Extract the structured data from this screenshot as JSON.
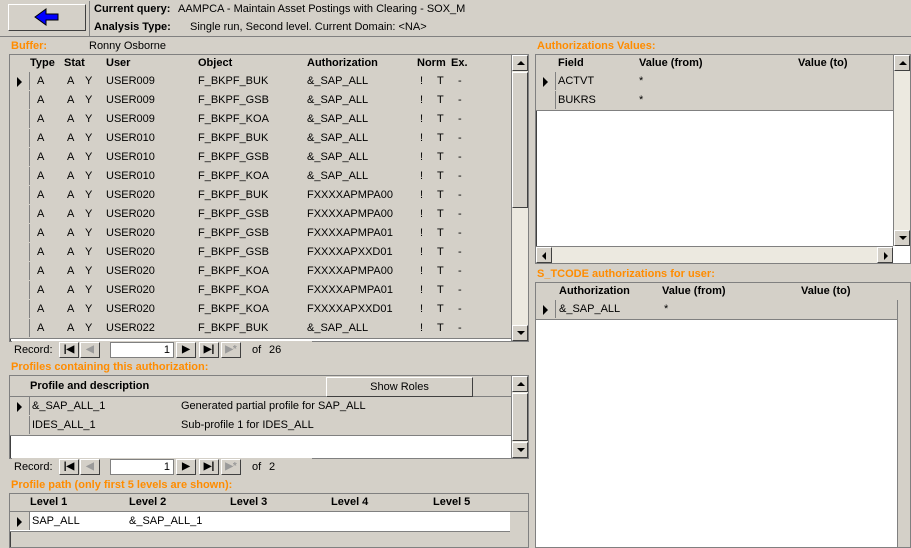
{
  "header": {
    "current_query_label": "Current query:",
    "current_query_value": "AAMPCA - Maintain Asset Postings with Clearing - SOX_M",
    "analysis_type_label": "Analysis Type:",
    "analysis_type_value": "Single run, Second level. Current Domain: <NA>",
    "back_button_icon": "arrow-left-icon"
  },
  "buffer": {
    "label": "Buffer:",
    "user_name": "Ronny Osborne",
    "columns": [
      "Type",
      "Stat",
      "User",
      "Object",
      "Authorization",
      "Norm",
      "Ex."
    ],
    "rows": [
      {
        "type": "A",
        "stat": "A",
        "y": "Y",
        "user": "USER009",
        "object": "F_BKPF_BUK",
        "auth": "&_SAP_ALL",
        "norm": "!",
        "t": "T",
        "ex": "-"
      },
      {
        "type": "A",
        "stat": "A",
        "y": "Y",
        "user": "USER009",
        "object": "F_BKPF_GSB",
        "auth": "&_SAP_ALL",
        "norm": "!",
        "t": "T",
        "ex": "-"
      },
      {
        "type": "A",
        "stat": "A",
        "y": "Y",
        "user": "USER009",
        "object": "F_BKPF_KOA",
        "auth": "&_SAP_ALL",
        "norm": "!",
        "t": "T",
        "ex": "-"
      },
      {
        "type": "A",
        "stat": "A",
        "y": "Y",
        "user": "USER010",
        "object": "F_BKPF_BUK",
        "auth": "&_SAP_ALL",
        "norm": "!",
        "t": "T",
        "ex": "-"
      },
      {
        "type": "A",
        "stat": "A",
        "y": "Y",
        "user": "USER010",
        "object": "F_BKPF_GSB",
        "auth": "&_SAP_ALL",
        "norm": "!",
        "t": "T",
        "ex": "-"
      },
      {
        "type": "A",
        "stat": "A",
        "y": "Y",
        "user": "USER010",
        "object": "F_BKPF_KOA",
        "auth": "&_SAP_ALL",
        "norm": "!",
        "t": "T",
        "ex": "-"
      },
      {
        "type": "A",
        "stat": "A",
        "y": "Y",
        "user": "USER020",
        "object": "F_BKPF_BUK",
        "auth": "FXXXXAPMPA00",
        "norm": "!",
        "t": "T",
        "ex": "-"
      },
      {
        "type": "A",
        "stat": "A",
        "y": "Y",
        "user": "USER020",
        "object": "F_BKPF_GSB",
        "auth": "FXXXXAPMPA00",
        "norm": "!",
        "t": "T",
        "ex": "-"
      },
      {
        "type": "A",
        "stat": "A",
        "y": "Y",
        "user": "USER020",
        "object": "F_BKPF_GSB",
        "auth": "FXXXXAPMPA01",
        "norm": "!",
        "t": "T",
        "ex": "-"
      },
      {
        "type": "A",
        "stat": "A",
        "y": "Y",
        "user": "USER020",
        "object": "F_BKPF_GSB",
        "auth": "FXXXXAPXXD01",
        "norm": "!",
        "t": "T",
        "ex": "-"
      },
      {
        "type": "A",
        "stat": "A",
        "y": "Y",
        "user": "USER020",
        "object": "F_BKPF_KOA",
        "auth": "FXXXXAPMPA00",
        "norm": "!",
        "t": "T",
        "ex": "-"
      },
      {
        "type": "A",
        "stat": "A",
        "y": "Y",
        "user": "USER020",
        "object": "F_BKPF_KOA",
        "auth": "FXXXXAPMPA01",
        "norm": "!",
        "t": "T",
        "ex": "-"
      },
      {
        "type": "A",
        "stat": "A",
        "y": "Y",
        "user": "USER020",
        "object": "F_BKPF_KOA",
        "auth": "FXXXXAPXXD01",
        "norm": "!",
        "t": "T",
        "ex": "-"
      },
      {
        "type": "A",
        "stat": "A",
        "y": "Y",
        "user": "USER022",
        "object": "F_BKPF_BUK",
        "auth": "&_SAP_ALL",
        "norm": "!",
        "t": "T",
        "ex": "-"
      }
    ],
    "record_label": "Record:",
    "record_current": "1",
    "record_of": "of",
    "record_total": "26"
  },
  "profiles": {
    "title": "Profiles containing this authorization:",
    "column": "Profile and description",
    "show_roles": "Show Roles",
    "rows": [
      {
        "profile": "&_SAP_ALL_1",
        "desc": "Generated partial profile for SAP_ALL"
      },
      {
        "profile": "IDES_ALL_1",
        "desc": "Sub-profile 1 for IDES_ALL"
      }
    ],
    "record_label": "Record:",
    "record_current": "1",
    "record_of": "of",
    "record_total": "2"
  },
  "profile_path": {
    "title": "Profile path (only first 5 levels are shown):",
    "columns": [
      "Level 1",
      "Level 2",
      "Level 3",
      "Level 4",
      "Level 5"
    ],
    "row": [
      "SAP_ALL",
      "&_SAP_ALL_1",
      "",
      "",
      ""
    ]
  },
  "auth_values": {
    "title": "Authorizations Values:",
    "columns": [
      "Field",
      "Value (from)",
      "Value (to)"
    ],
    "rows": [
      {
        "field": "ACTVT",
        "from": "*",
        "to": ""
      },
      {
        "field": "BUKRS",
        "from": "*",
        "to": ""
      }
    ]
  },
  "tcode": {
    "title": "S_TCODE authorizations for user:",
    "columns": [
      "Authorization",
      "Value (from)",
      "Value (to)"
    ],
    "rows": [
      {
        "auth": "&_SAP_ALL",
        "from": "*",
        "to": ""
      }
    ]
  },
  "colors": {
    "section_title": "#ff8c00",
    "background": "#d4d0c8",
    "arrow": "#0000ff"
  }
}
